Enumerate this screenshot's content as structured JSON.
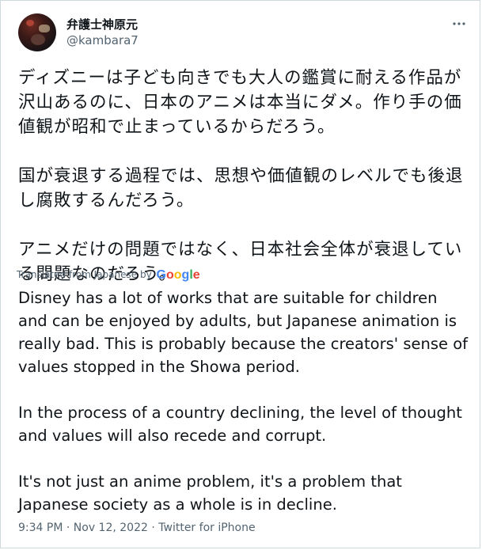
{
  "tweet": {
    "author": {
      "display_name": "弁護士神原元",
      "handle": "@kambara7"
    },
    "more_icon": "more-dots-icon",
    "original_text": [
      "ディズニーは子ども向きでも大人の鑑賞に耐える作品が沢山あるのに、日本のアニメは本当にダメ。作り手の価値観が昭和で止まっているからだろう。",
      "国が衰退する過程では、思想や価値観のレベルでも後退し腐敗するんだろう。",
      "アニメだけの問題ではなく、日本社会全体が衰退している問題なのだろう。"
    ],
    "translation_label": "Translated from Japanese by",
    "translation_provider": [
      "G",
      "o",
      "o",
      "g",
      "l",
      "e"
    ],
    "translated_text": [
      "Disney has a lot of works that are suitable for children and can be enjoyed by adults, but Japanese animation is really bad. This is probably because the creators' sense of values stopped in the Showa period.",
      "In the process of a country declining, the level of thought and values will also recede and corrupt.",
      "It's not just an anime problem, it's a problem that Japanese society as a whole is in decline."
    ],
    "time": "9:34 PM",
    "date": "Nov 12, 2022",
    "source": "Twitter for iPhone",
    "separator": "·"
  }
}
